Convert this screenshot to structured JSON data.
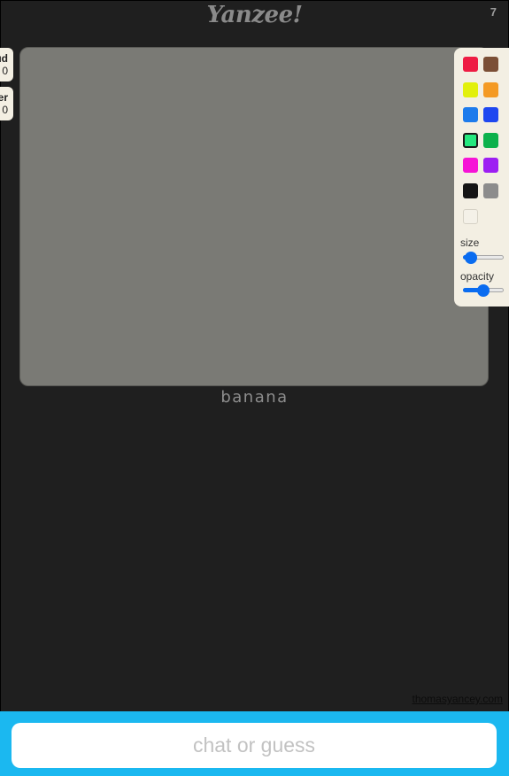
{
  "app": {
    "logo": "Yanzee!",
    "round": "7"
  },
  "players": [
    {
      "name": "ud",
      "score": "0"
    },
    {
      "name": "er",
      "score": "0"
    }
  ],
  "word": "banana",
  "palette": {
    "colors": [
      {
        "name": "red",
        "hex": "#ee1c43"
      },
      {
        "name": "brown",
        "hex": "#7b4f36"
      },
      {
        "name": "yellow",
        "hex": "#e2f00c"
      },
      {
        "name": "orange",
        "hex": "#f49a24"
      },
      {
        "name": "light-blue",
        "hex": "#1d7bec"
      },
      {
        "name": "blue",
        "hex": "#1e47f0"
      },
      {
        "name": "light-green",
        "hex": "#25e87e"
      },
      {
        "name": "green",
        "hex": "#0cb14b"
      },
      {
        "name": "magenta",
        "hex": "#f614d6"
      },
      {
        "name": "purple",
        "hex": "#9d1ff2"
      },
      {
        "name": "black",
        "hex": "#151515"
      },
      {
        "name": "gray",
        "hex": "#8c8c8c"
      },
      {
        "name": "white",
        "hex": "#f4f1e8"
      }
    ],
    "selected_color": "light-green",
    "size_label": "size",
    "size_value": 0.05,
    "opacity_label": "opacity",
    "opacity_value": 0.5
  },
  "footer": {
    "credit": "thomasyancey.com",
    "chat_placeholder": "chat or guess"
  },
  "colors": {
    "background": "#1f1f1f",
    "canvas": "#7a7a75",
    "chat_bar": "#1bb8f0",
    "slider_accent": "#0a6cf0"
  }
}
